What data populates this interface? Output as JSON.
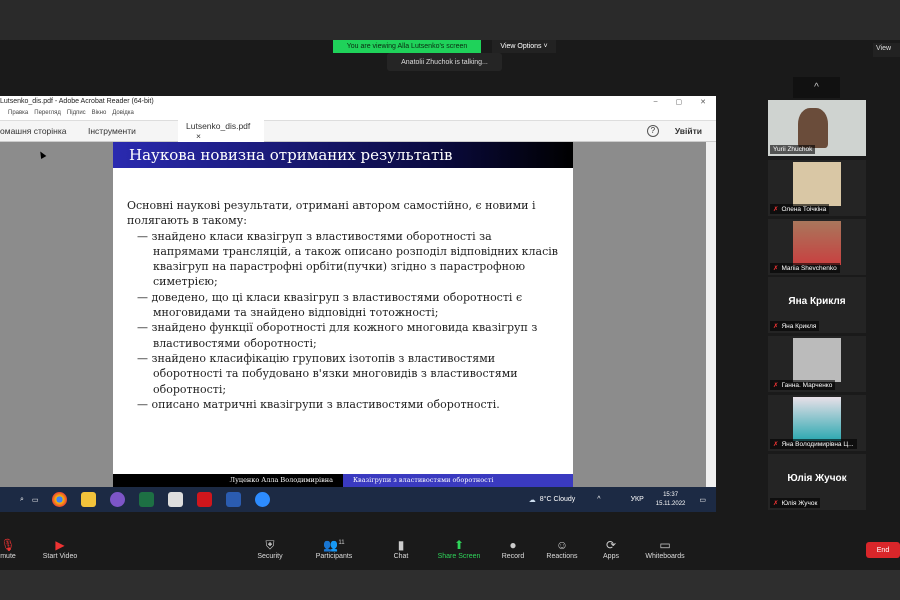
{
  "zoom": {
    "viewing_banner": "You are viewing Alla Lutsenko's screen",
    "view_options": "View Options ˅",
    "talking": "Anatolii Zhuchok is talking...",
    "view_btn": "View",
    "up_arrow": "^"
  },
  "acrobat": {
    "title": "Lutsenko_dis.pdf - Adobe Acrobat Reader (64-bit)",
    "menu": [
      "Правка",
      "Перегляд",
      "Підпис",
      "Вікно",
      "Довідка"
    ],
    "tabs": {
      "home": "омашня сторінка",
      "tools": "Інструменти",
      "doc": "Lutsenko_dis.pdf",
      "close": "×"
    },
    "help": "?",
    "signin": "Увійти",
    "win": {
      "min": "–",
      "max": "▢",
      "close": "✕"
    }
  },
  "slide": {
    "title": "Наукова новизна отриманих результатів",
    "intro": "Основні наукові результати, отримані автором самостійно, є новими і полягають в такому:",
    "items": [
      "— знайдено класи квазігруп з властивостями оборотності за напрямами трансляцій, а також описано розподіл відповідних класів квазігруп на парастрофні орбіти(пучки) згідно з парастрофною симетрією;",
      "— доведено, що ці класи квазігруп з властивостями оборотності є многовидами та знайдено відповідні тотожності;",
      "— знайдено функції оборотності для кожного многовида квазігруп з властивостями оборотності;",
      "— знайдено класифікацію групових ізотопів з властивостями оборотності та побудовано в'язки многовидів з властивостями оборотності;",
      "— описано матричні квазігрупи з властивостями оборотності."
    ],
    "footer_author": "Луценко Алла Володимирівна",
    "footer_topic": "Квазігрупи з властивостями оборотності"
  },
  "taskbar": {
    "weather": "8°C  Cloudy",
    "lang": "УКР",
    "time": "15:37",
    "date": "15.11.2022"
  },
  "participants": [
    {
      "name": "Yurii Zhuchok"
    },
    {
      "name": "Олена Тоічкіна"
    },
    {
      "name": "Mariia Shevchenko"
    },
    {
      "name": "Яна Крикля",
      "big": "Яна Крикля"
    },
    {
      "name": "Ганна. Марченко"
    },
    {
      "name": "Яна Володимирівна Ц..."
    },
    {
      "name": "Юлія Жучок",
      "big": "Юлія Жучок"
    }
  ],
  "toolbar": {
    "mute": "mute",
    "video": "Start Video",
    "security": "Security",
    "participants": "Participants",
    "participants_count": "11",
    "chat": "Chat",
    "share": "Share Screen",
    "record": "Record",
    "reactions": "Reactions",
    "apps": "Apps",
    "whiteboards": "Whiteboards",
    "end": "End"
  }
}
